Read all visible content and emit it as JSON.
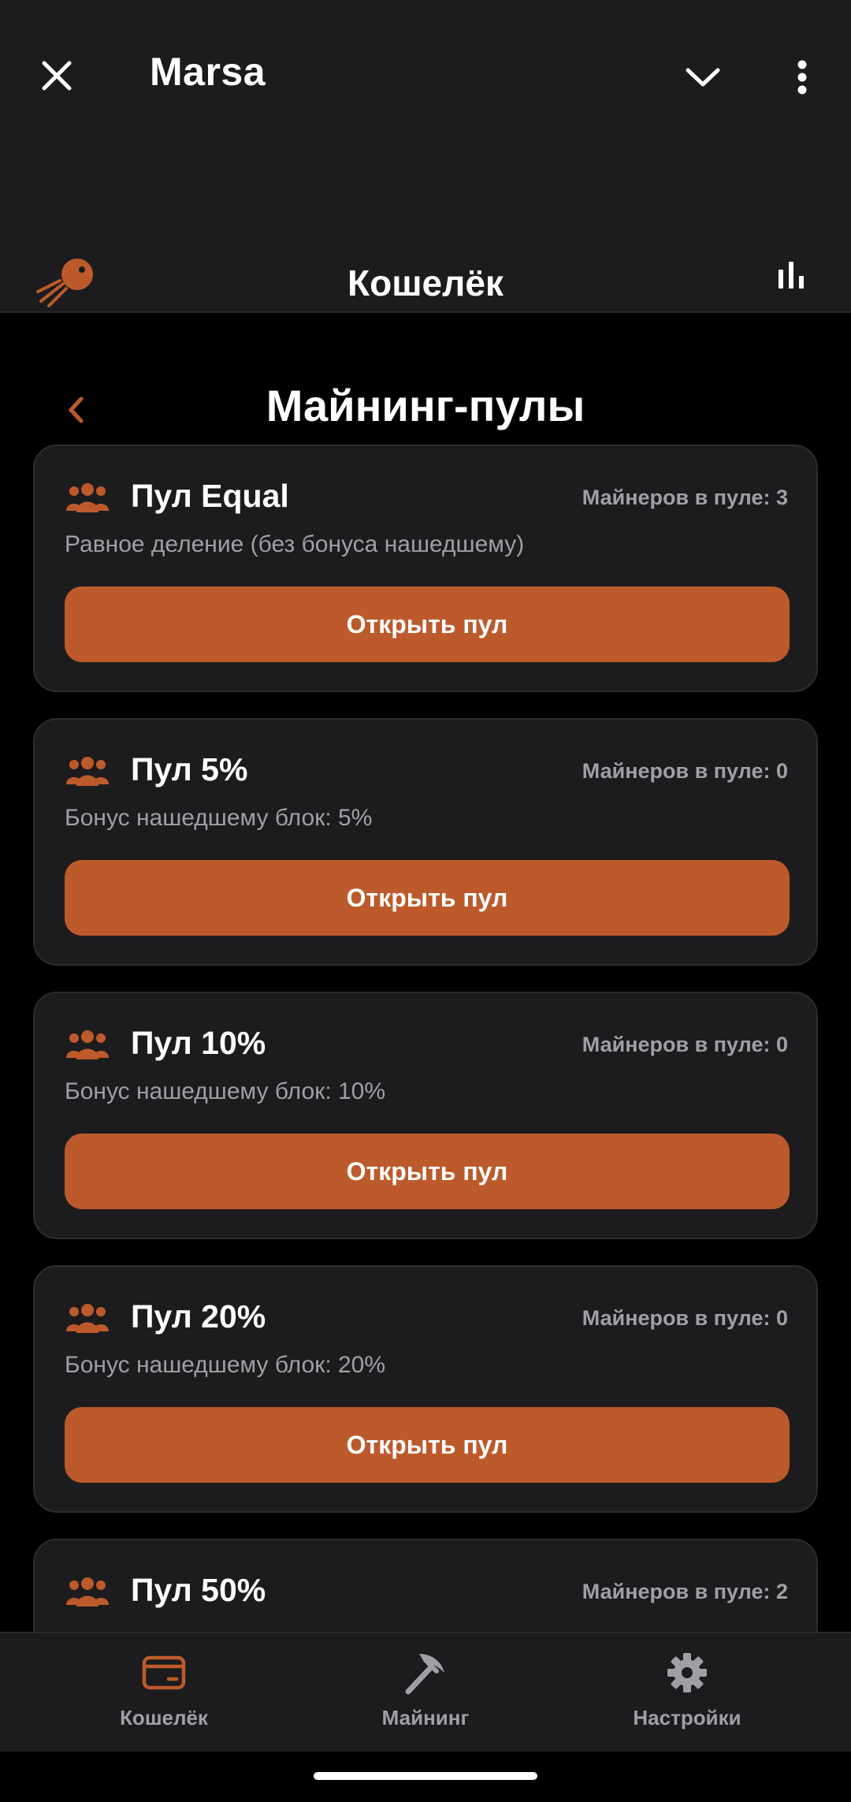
{
  "app": {
    "title": "Marsa"
  },
  "header": {
    "title": "Кошелёк"
  },
  "page": {
    "title": "Майнинг-пулы"
  },
  "colors": {
    "accent": "#bd5a2b",
    "card_bg": "#1c1c1e",
    "muted_text": "#a0a0a4"
  },
  "pools": [
    {
      "name": "Пул Equal",
      "miners": "Майнеров в пуле: 3",
      "description": "Равное деление (без бонуса нашедшему)",
      "button": "Открыть пул"
    },
    {
      "name": "Пул 5%",
      "miners": "Майнеров в пуле: 0",
      "description": "Бонус нашедшему блок: 5%",
      "button": "Открыть пул"
    },
    {
      "name": "Пул 10%",
      "miners": "Майнеров в пуле: 0",
      "description": "Бонус нашедшему блок: 10%",
      "button": "Открыть пул"
    },
    {
      "name": "Пул 20%",
      "miners": "Майнеров в пуле: 0",
      "description": "Бонус нашедшему блок: 20%",
      "button": "Открыть пул"
    },
    {
      "name": "Пул 50%",
      "miners": "Майнеров в пуле: 2"
    }
  ],
  "bottom_nav": [
    {
      "label": "Кошелёк",
      "icon": "wallet-icon",
      "active": true
    },
    {
      "label": "Майнинг",
      "icon": "pickaxe-icon",
      "active": false
    },
    {
      "label": "Настройки",
      "icon": "gear-icon",
      "active": false
    }
  ]
}
